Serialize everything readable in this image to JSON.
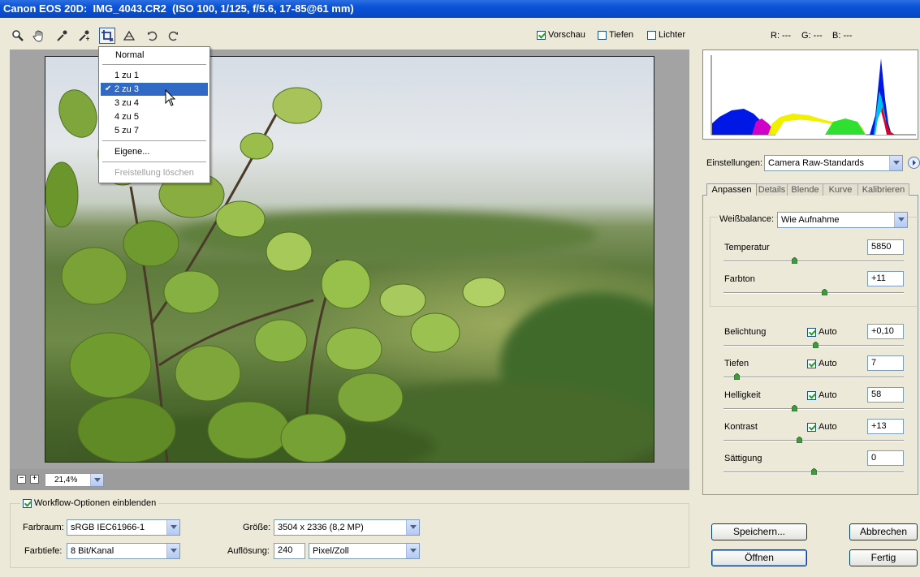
{
  "window": {
    "title": "Canon EOS 20D:  IMG_4043.CR2  (ISO 100, 1/125, f/5.6, 17-85@61 mm)"
  },
  "toolbar": {
    "tools": [
      "zoom-icon",
      "hand-icon",
      "white-balance-eyedropper-icon",
      "color-sampler-icon",
      "crop-icon",
      "straighten-icon",
      "rotate-left-icon",
      "rotate-right-icon"
    ],
    "preview_label": "Vorschau",
    "preview_checked": true,
    "shadows_label": "Tiefen",
    "shadows_checked": false,
    "highlights_label": "Lichter",
    "highlights_checked": false,
    "rgb_readout": {
      "r": "R: ---",
      "g": "G: ---",
      "b": "B: ---"
    }
  },
  "crop_menu": {
    "normal": "Normal",
    "ratios": [
      "1 zu 1",
      "2 zu 3",
      "3 zu 4",
      "4 zu 5",
      "5 zu 7"
    ],
    "selected": "2 zu 3",
    "custom": "Eigene...",
    "clear": "Freistellung löschen",
    "check_glyph": "✔"
  },
  "zoom": {
    "minus": "−",
    "plus": "+",
    "value": "21,4%"
  },
  "settings": {
    "label": "Einstellungen:",
    "value": "Camera Raw-Standards"
  },
  "tabs": [
    "Anpassen",
    "Details",
    "Blende",
    "Kurve",
    "Kalibrieren"
  ],
  "adjust": {
    "white_balance_label": "Weißbalance:",
    "white_balance_value": "Wie Aufnahme",
    "auto_label": "Auto",
    "sliders": [
      {
        "label": "Temperatur",
        "value": "5850",
        "auto": null,
        "level": 0.39
      },
      {
        "label": "Farbton",
        "value": "+11",
        "auto": null,
        "level": 0.56
      },
      {
        "label": "Belichtung",
        "value": "+0,10",
        "auto": true,
        "level": 0.51
      },
      {
        "label": "Tiefen",
        "value": "7",
        "auto": true,
        "level": 0.07
      },
      {
        "label": "Helligkeit",
        "value": "58",
        "auto": true,
        "level": 0.39
      },
      {
        "label": "Kontrast",
        "value": "+13",
        "auto": true,
        "level": 0.42
      },
      {
        "label": "Sättigung",
        "value": "0",
        "auto": null,
        "level": 0.5
      }
    ]
  },
  "buttons": {
    "save": "Speichern...",
    "cancel": "Abbrechen",
    "open": "Öffnen",
    "done": "Fertig"
  },
  "workflow": {
    "toggle_label": "Workflow-Optionen einblenden",
    "toggle_checked": true,
    "color_space_label": "Farbraum:",
    "color_space_value": "sRGB IEC61966-1",
    "bit_depth_label": "Farbtiefe:",
    "bit_depth_value": "8 Bit/Kanal",
    "size_label": "Größe:",
    "size_value": "3504 x 2336 (8,2 MP)",
    "resolution_label": "Auflösung:",
    "resolution_value": "240",
    "resolution_unit": "Pixel/Zoll"
  }
}
